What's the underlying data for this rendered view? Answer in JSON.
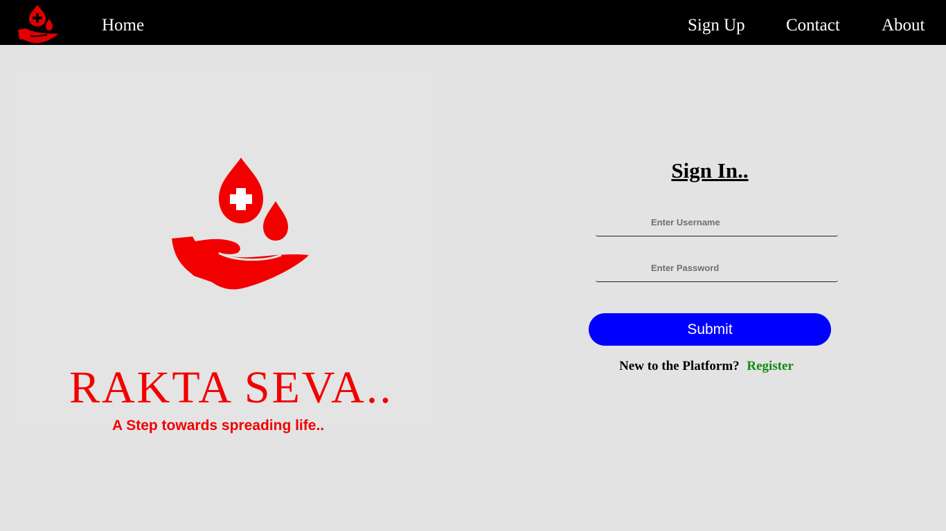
{
  "navbar": {
    "logo_icon": "blood-drop-hand-icon",
    "links": {
      "home": "Home",
      "sign_up": "Sign Up",
      "contact": "Contact",
      "about": "About"
    },
    "background": "#000000",
    "text_color": "#ffffff"
  },
  "hero": {
    "logo_icon": "blood-drop-hand-icon",
    "brand_name": "RAKTA SEVA..",
    "tagline": "A Step towards spreading life..",
    "brand_color": "#f20000"
  },
  "signin": {
    "title": "Sign In..",
    "username_placeholder": "Enter Username",
    "password_placeholder": "Enter Password",
    "username_value": "",
    "password_value": "",
    "submit_label": "Submit",
    "submit_color": "#0000ff",
    "register_prompt": "New to the Platform?",
    "register_link": "Register",
    "register_color": "#138a13"
  }
}
